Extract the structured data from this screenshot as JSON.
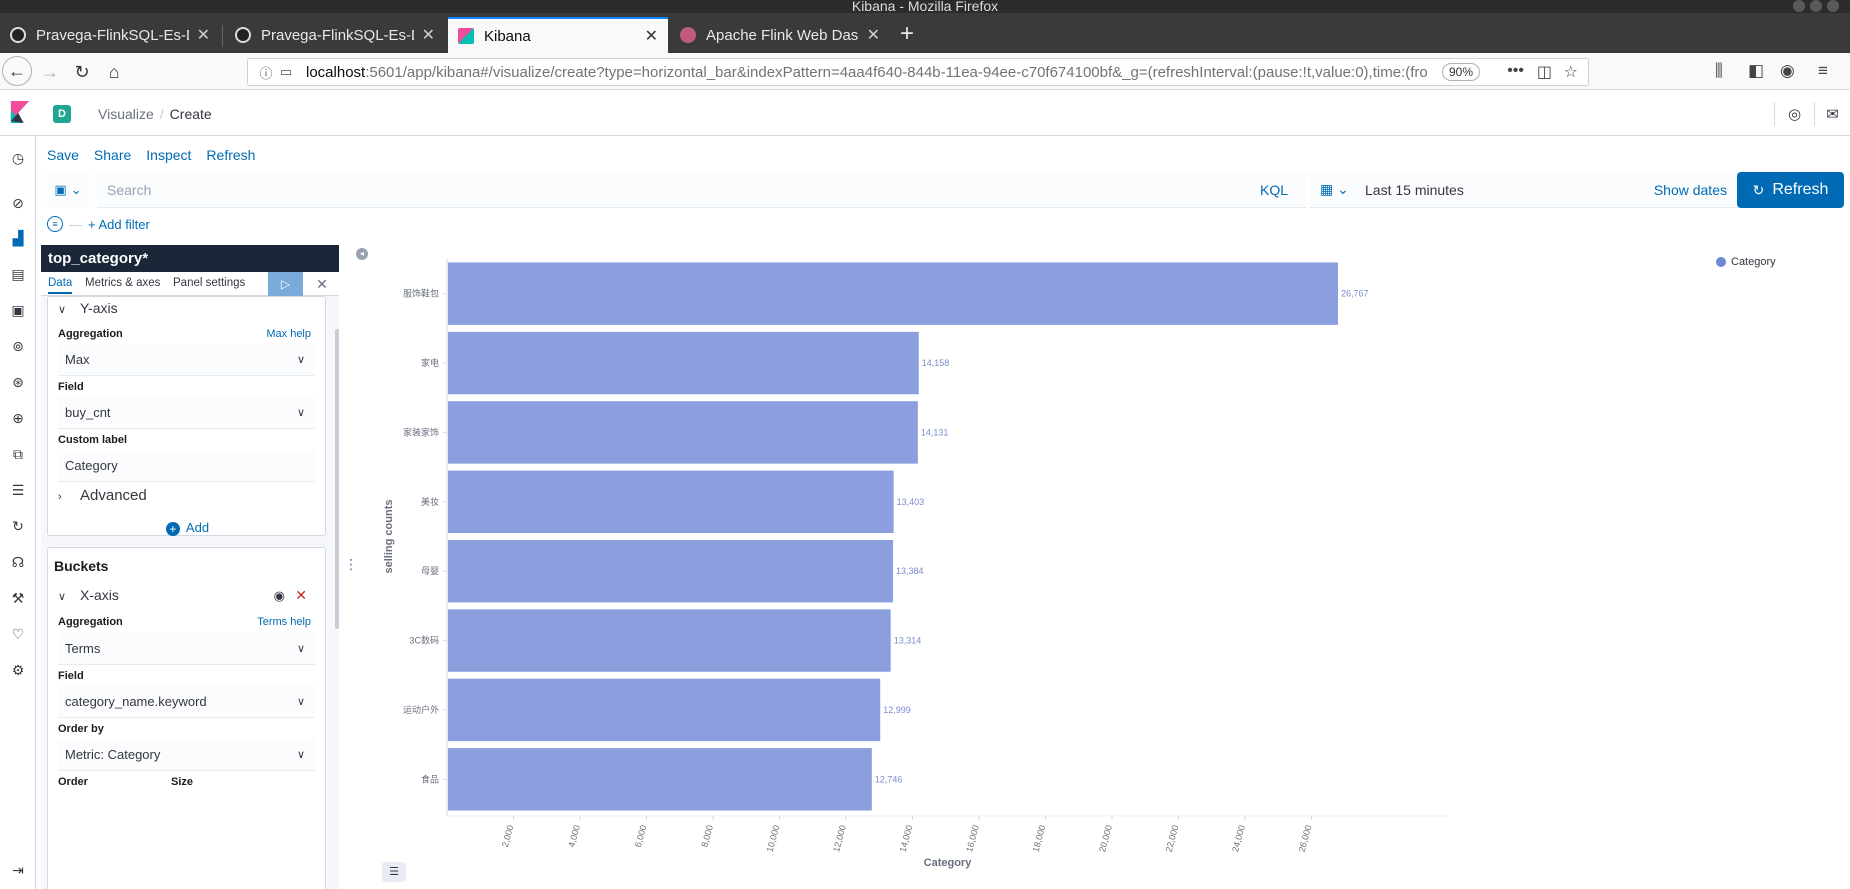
{
  "window": {
    "title": "Kibana - Mozilla Firefox"
  },
  "tabs": [
    {
      "title": "Pravega-FlinkSQL-Es-Dem",
      "favicon": "github-icon"
    },
    {
      "title": "Pravega-FlinkSQL-Es-Dem",
      "favicon": "github-icon"
    },
    {
      "title": "Kibana",
      "favicon": "kibana-icon",
      "active": true
    },
    {
      "title": "Apache Flink Web Dashb",
      "favicon": "flink-icon"
    }
  ],
  "navbar": {
    "url_host": "localhost",
    "url_rest": ":5601/app/kibana#/visualize/create?type=horizontal_bar&indexPattern=4aa4f640-844b-11ea-94ee-c70f674100bf&_g=(refreshInterval:(pause:!t,value:0),time:(fro",
    "zoom": "90%"
  },
  "kibana": {
    "space_badge": "D",
    "breadcrumb": [
      "Visualize",
      "Create"
    ],
    "top_menu": [
      "Save",
      "Share",
      "Inspect",
      "Refresh"
    ],
    "search_placeholder": "Search",
    "kql": "KQL",
    "time_range": "Last 15 minutes",
    "show_dates": "Show dates",
    "refresh_button": "Refresh",
    "add_filter": "+ Add filter"
  },
  "editor": {
    "title": "top_category*",
    "tabs": [
      "Data",
      "Metrics & axes",
      "Panel settings"
    ],
    "metrics": {
      "section": "Y-axis",
      "aggregation_label": "Aggregation",
      "aggregation_help": "Max help",
      "aggregation_value": "Max",
      "field_label": "Field",
      "field_value": "buy_cnt",
      "custom_label_label": "Custom label",
      "custom_label_value": "Category",
      "advanced": "Advanced",
      "add": "Add"
    },
    "buckets": {
      "title": "Buckets",
      "section": "X-axis",
      "aggregation_label": "Aggregation",
      "aggregation_help": "Terms help",
      "aggregation_value": "Terms",
      "field_label": "Field",
      "field_value": "category_name.keyword",
      "order_by_label": "Order by",
      "order_by_value": "Metric: Category",
      "order_label": "Order",
      "size_label": "Size"
    }
  },
  "colors": {
    "bar": "#8b9fdf",
    "accent": "#006bb4",
    "legend": "#6f87d8"
  },
  "chart_data": {
    "type": "bar",
    "orientation": "horizontal",
    "categories": [
      "服饰鞋包",
      "家电",
      "家装家饰",
      "美妆",
      "母婴",
      "3C数码",
      "运动户外",
      "食品"
    ],
    "series": [
      {
        "name": "Category",
        "values": [
          26767,
          14158,
          14131,
          13403,
          13384,
          13314,
          12999,
          12746
        ]
      }
    ],
    "data_labels": [
      "26,767",
      "14,158",
      "14,131",
      "13,403",
      "13,384",
      "13,314",
      "12,999",
      "12,746"
    ],
    "xlabel": "Category",
    "ylabel": "selling counts",
    "xlim": [
      0,
      28000
    ],
    "xticks": [
      "2,000",
      "4,000",
      "6,000",
      "8,000",
      "10,000",
      "12,000",
      "14,000",
      "16,000",
      "18,000",
      "20,000",
      "22,000",
      "24,000",
      "26,000"
    ],
    "legend": "top-right"
  }
}
